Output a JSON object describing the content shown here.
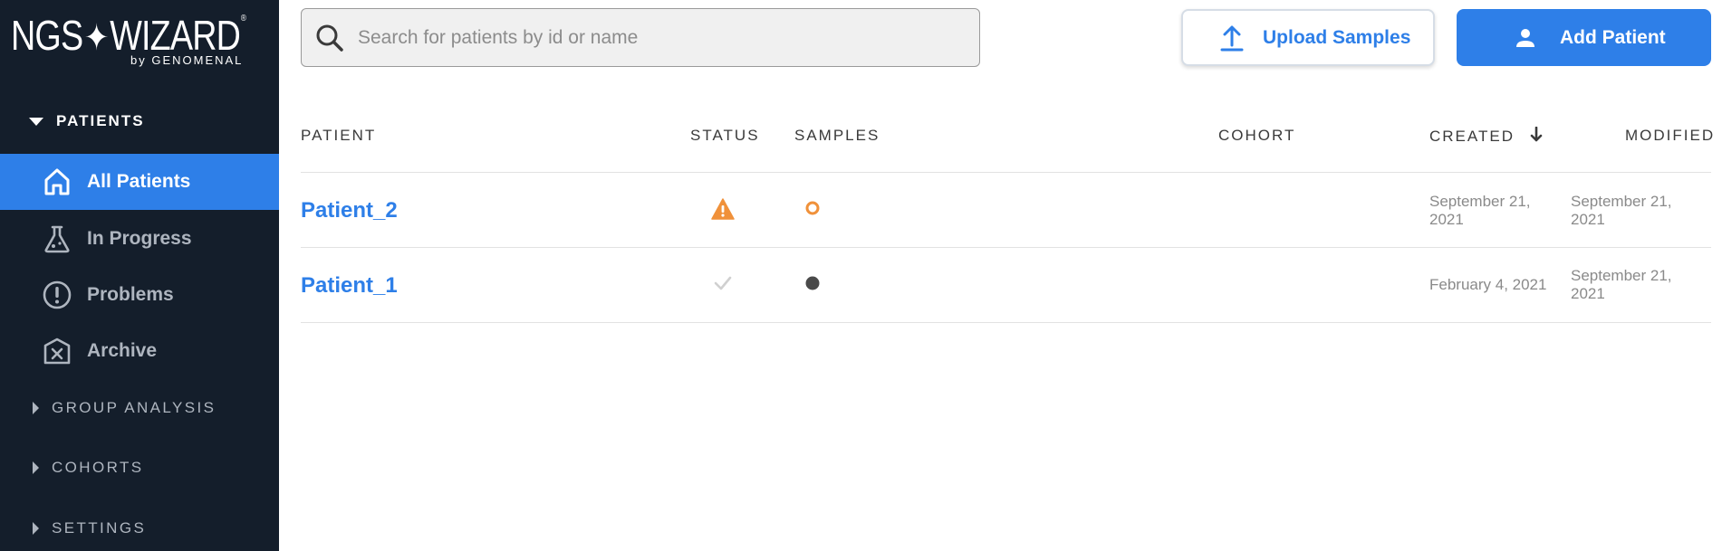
{
  "logo": {
    "text": "NGS",
    "text2": "WIZARD",
    "reg": "®",
    "byline": "by GENOMENAL"
  },
  "sidebar": {
    "patients_section": "PATIENTS",
    "items": [
      {
        "label": "All Patients",
        "icon": "home-icon",
        "active": true
      },
      {
        "label": "In Progress",
        "icon": "flask-icon",
        "active": false
      },
      {
        "label": "Problems",
        "icon": "exclamation-circle-icon",
        "active": false
      },
      {
        "label": "Archive",
        "icon": "archive-icon",
        "active": false
      }
    ],
    "group_analysis": "GROUP ANALYSIS",
    "cohorts": "COHORTS",
    "settings": "SETTINGS"
  },
  "search": {
    "placeholder": "Search for patients by id or name",
    "value": ""
  },
  "toolbar": {
    "upload_label": "Upload Samples",
    "add_label": "Add Patient"
  },
  "table": {
    "headers": {
      "patient": "PATIENT",
      "status": "STATUS",
      "samples": "SAMPLES",
      "cohort": "COHORT",
      "created": "CREATED",
      "modified": "MODIFIED"
    },
    "sort": "created-desc",
    "rows": [
      {
        "patient": "Patient_2",
        "status": "warning",
        "samples": "pending",
        "cohort": "",
        "created": "September 21, 2021",
        "modified": "September 21, 2021"
      },
      {
        "patient": "Patient_1",
        "status": "done",
        "samples": "complete",
        "cohort": "",
        "created": "February 4, 2021",
        "modified": "September 21, 2021"
      }
    ]
  },
  "colors": {
    "sidebar_bg": "#141e2b",
    "accent": "#2e7fe8",
    "warning": "#f0913a",
    "muted": "#aeb5bf"
  }
}
